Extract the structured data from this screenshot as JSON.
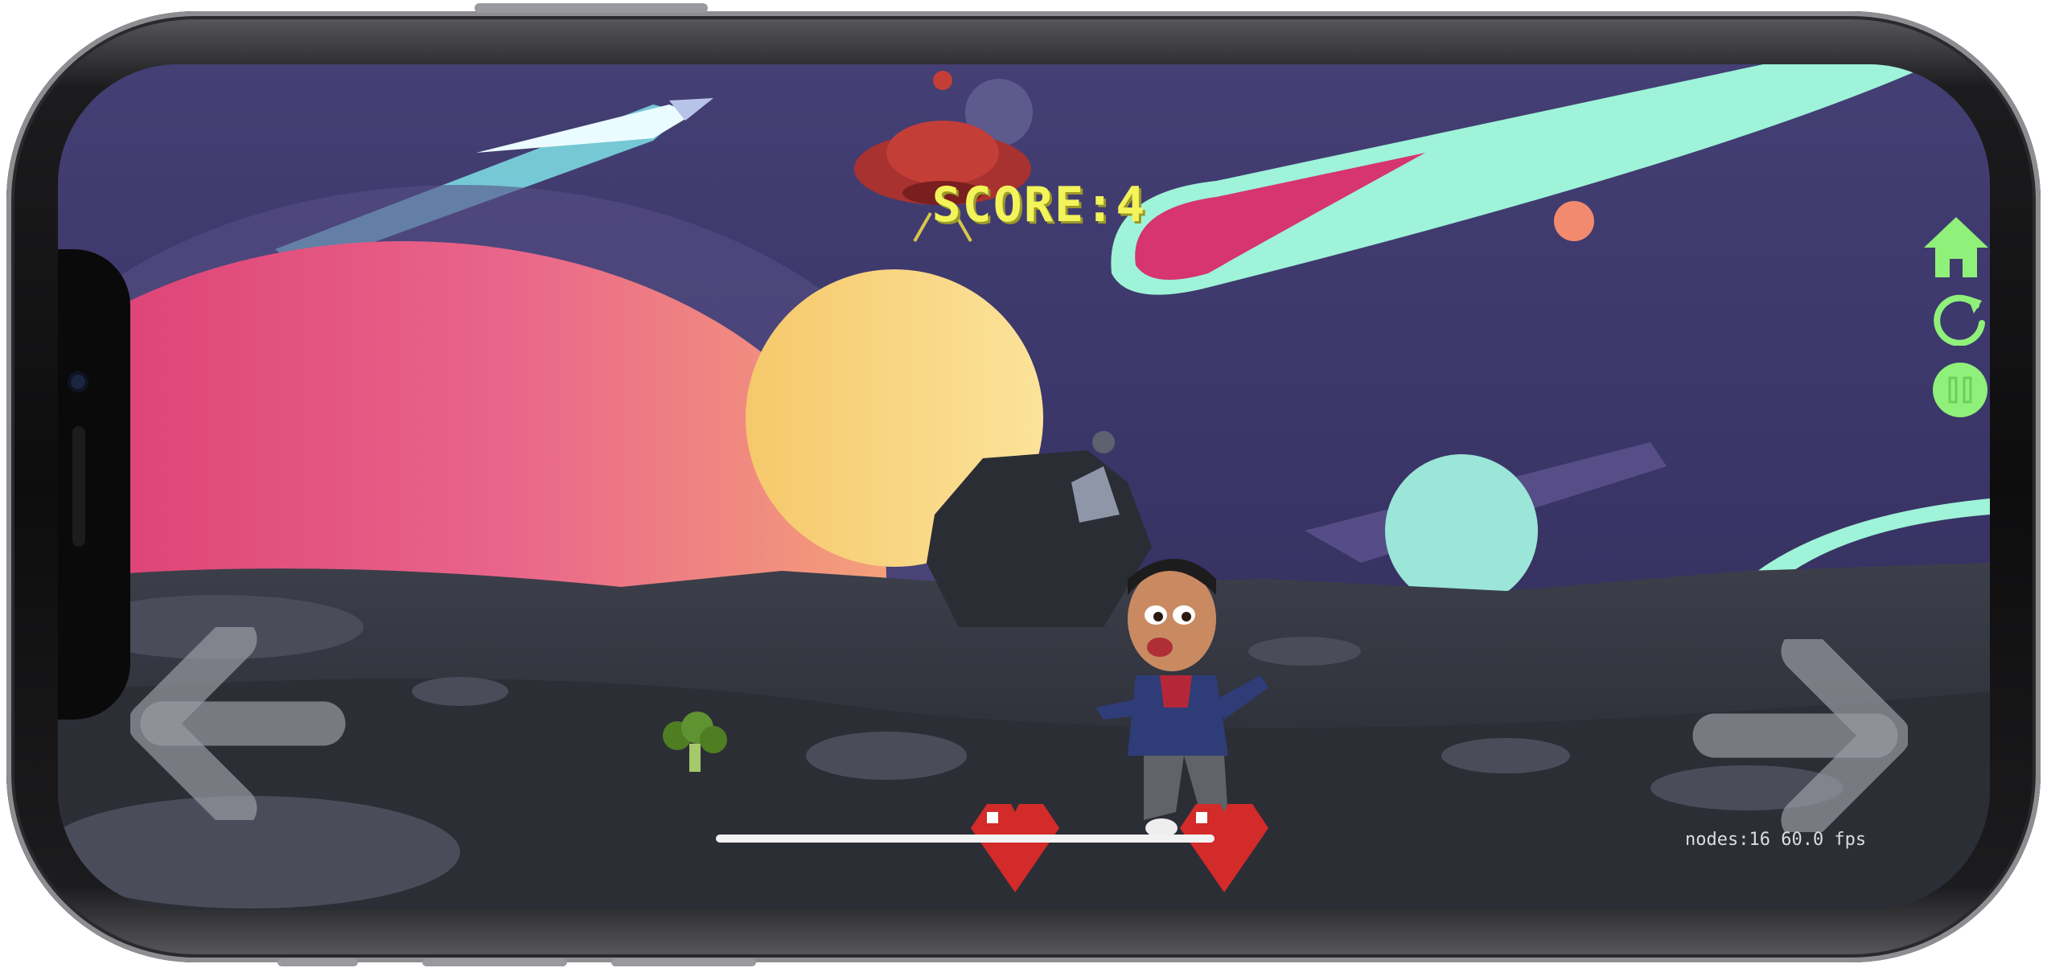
{
  "hud": {
    "score_text": "SCORE:4",
    "debug_text": "nodes:16   60.0 fps"
  },
  "lives": {
    "count": 2
  },
  "controls": {
    "home_icon": "home-icon",
    "restart_icon": "restart-icon",
    "pause_icon": "pause-icon",
    "left_arrow_icon": "left-arrow-icon",
    "right_arrow_icon": "right-arrow-icon"
  },
  "colors": {
    "score": "#f3f35a",
    "ui_green": "#8ff07a",
    "heart": "#d32a2a",
    "sky": "#3d3a6b"
  }
}
